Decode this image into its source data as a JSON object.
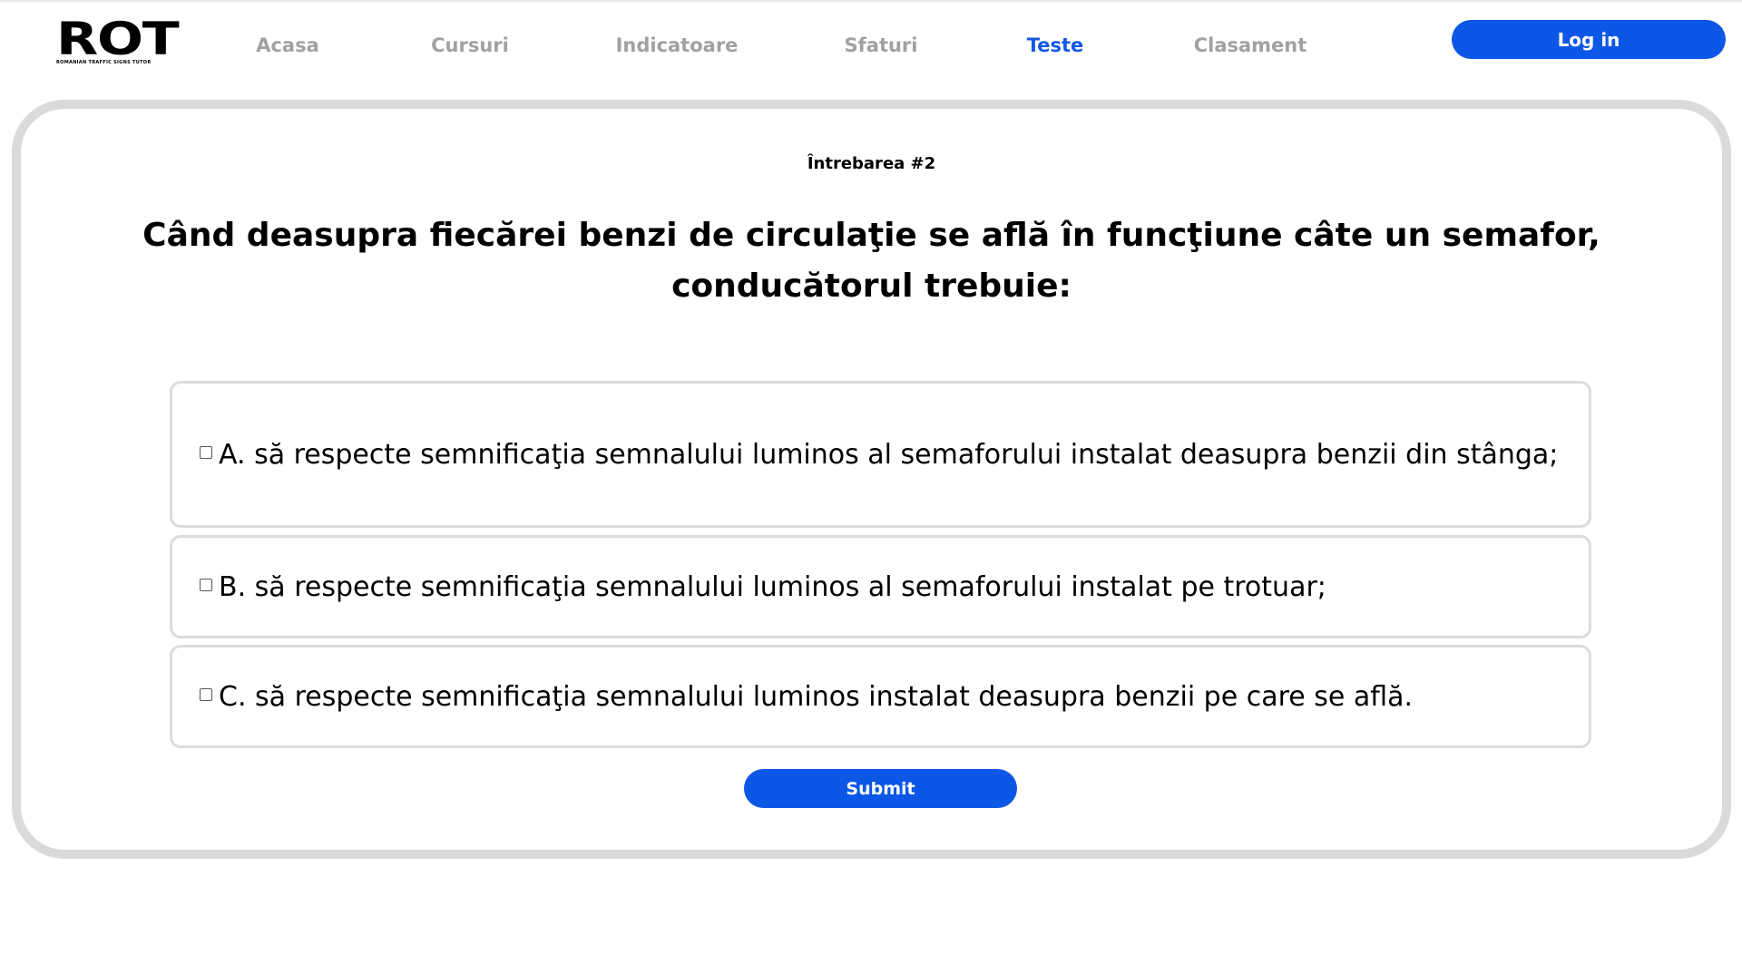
{
  "header": {
    "logo_text": "ROT",
    "logo_subtitle": "ROMANIAN TRAFFIC SIGNS TUTOR",
    "nav": [
      {
        "label": "Acasa",
        "active": false
      },
      {
        "label": "Cursuri",
        "active": false
      },
      {
        "label": "Indicatoare",
        "active": false
      },
      {
        "label": "Sfaturi",
        "active": false
      },
      {
        "label": "Teste",
        "active": true
      },
      {
        "label": "Clasament",
        "active": false
      }
    ],
    "login_label": "Log in"
  },
  "quiz": {
    "question_number": "Întrebarea #2",
    "question_text": "Când deasupra fiecărei benzi de circulaţie se află în funcţiune câte un semafor, conducătorul trebuie:",
    "options": [
      {
        "text": "A. să respecte semnificaţia semnalului luminos al semaforului instalat deasupra benzii din stânga;",
        "checked": false
      },
      {
        "text": "B. să respecte semnificaţia semnalului luminos al semaforului instalat pe trotuar;",
        "checked": false
      },
      {
        "text": "C. să respecte semnificaţia semnalului luminos instalat deasupra benzii pe care se află.",
        "checked": false
      }
    ],
    "submit_label": "Submit"
  },
  "colors": {
    "accent": "#0d57e6",
    "nav_inactive": "#a1a1a1",
    "card_border": "#dadada",
    "option_border": "#dcdcdc"
  }
}
